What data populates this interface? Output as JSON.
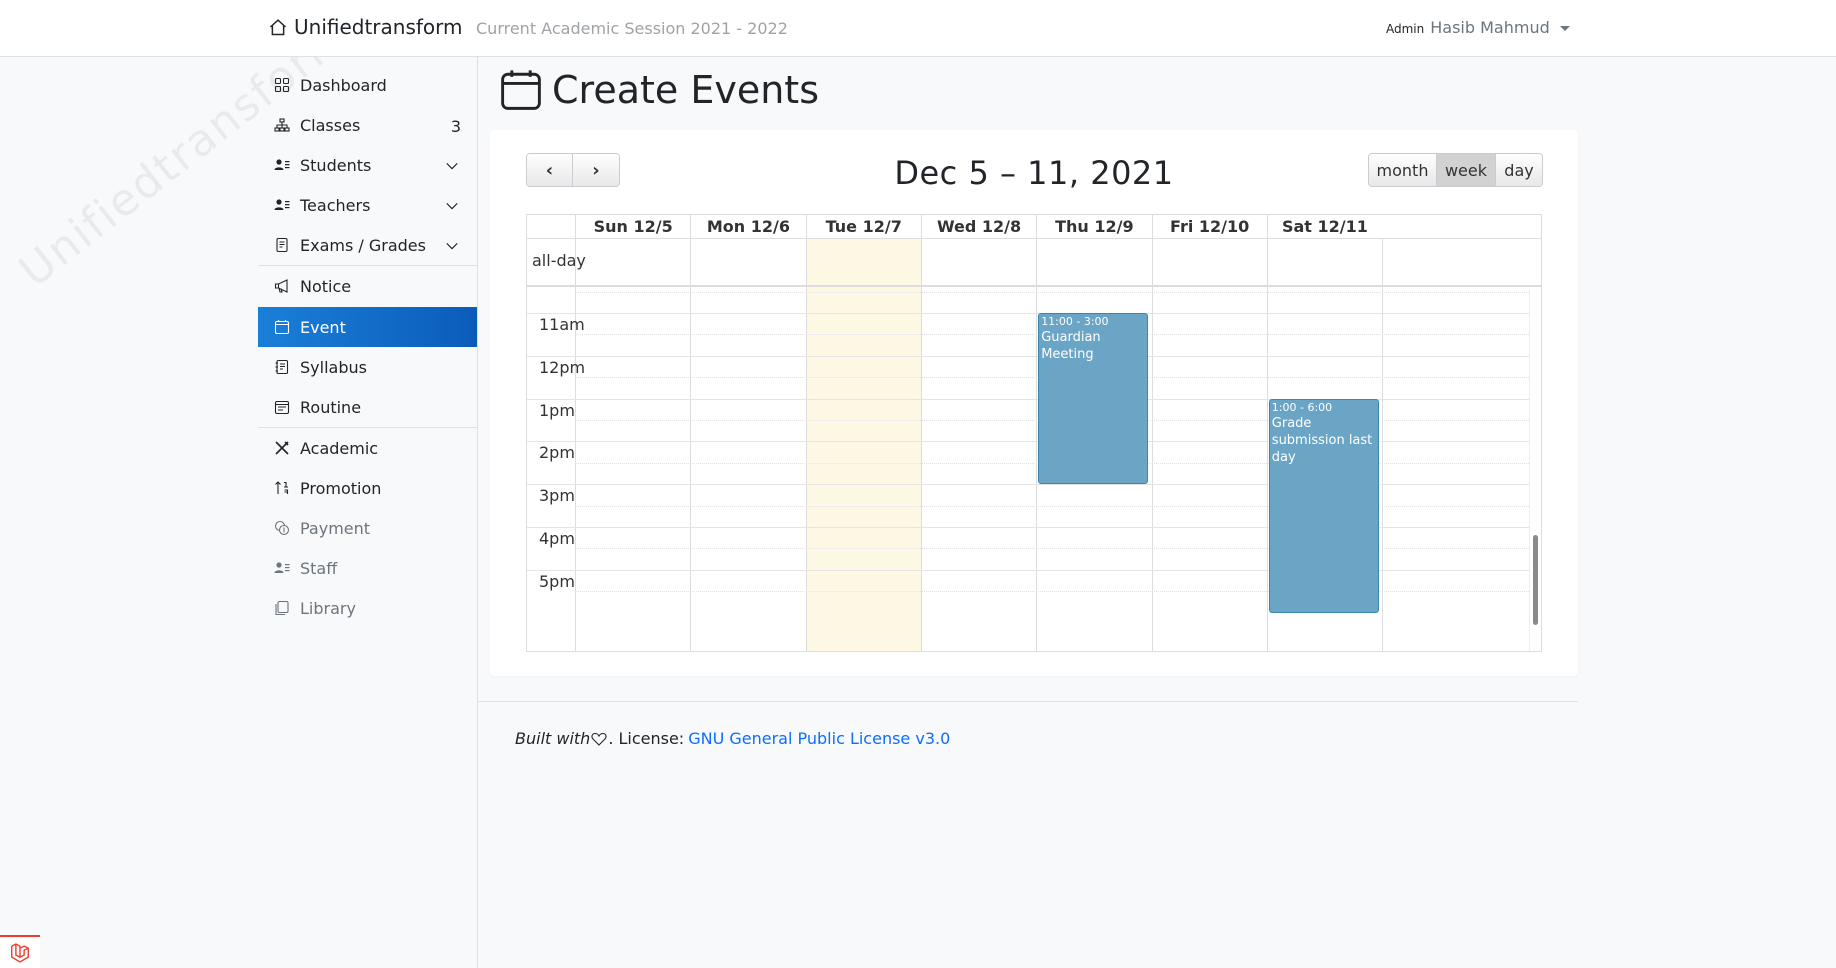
{
  "navbar": {
    "brand": "Unifiedtransform",
    "session": "Current Academic Session 2021 - 2022",
    "role": "Admin",
    "user_name": "Hasib Mahmud"
  },
  "sidebar": {
    "watermark": "Unifiedtransform",
    "items": [
      {
        "label": "Dashboard",
        "icon": "grid-icon"
      },
      {
        "label": "Classes",
        "icon": "diagram-icon",
        "badge": "3"
      },
      {
        "label": "Students",
        "icon": "person-lines-icon",
        "chevron": true
      },
      {
        "label": "Teachers",
        "icon": "person-lines-icon",
        "chevron": true
      },
      {
        "label": "Exams / Grades",
        "icon": "file-text-icon",
        "chevron": true
      },
      {
        "label": "Notice",
        "icon": "megaphone-icon"
      },
      {
        "label": "Event",
        "icon": "calendar-icon",
        "active": true
      },
      {
        "label": "Syllabus",
        "icon": "journal-text-icon"
      },
      {
        "label": "Routine",
        "icon": "calendar-week-icon"
      },
      {
        "label": "Academic",
        "icon": "tools-icon"
      },
      {
        "label": "Promotion",
        "icon": "sort-numeric-up-icon"
      },
      {
        "label": "Payment",
        "icon": "coin-icon",
        "muted": true
      },
      {
        "label": "Staff",
        "icon": "person-lines-icon",
        "muted": true
      },
      {
        "label": "Library",
        "icon": "journals-icon",
        "muted": true
      }
    ]
  },
  "page": {
    "title": "Create Events"
  },
  "calendar": {
    "prev_label": "‹",
    "next_label": "›",
    "range_title": "Dec 5 – 11, 2021",
    "views": [
      "month",
      "week",
      "day"
    ],
    "active_view": "week",
    "days": [
      "Sun 12/5",
      "Mon 12/6",
      "Tue 12/7",
      "Wed 12/8",
      "Thu 12/9",
      "Fri 12/10",
      "Sat 12/11"
    ],
    "today": "Tue 12/7",
    "allday_label": "all-day",
    "time_labels": [
      "11am",
      "12pm",
      "1pm",
      "2pm",
      "3pm",
      "4pm",
      "5pm"
    ],
    "events": [
      {
        "day": "Thu 12/9",
        "time": "11:00 - 3:00",
        "title": "Guardian Meeting",
        "color": "#6ba5c6"
      },
      {
        "day": "Sat 12/11",
        "time": "1:00 - 6:00",
        "title": "Grade submission last day",
        "color": "#6ba5c6"
      }
    ]
  },
  "footer": {
    "built_with": "Built with",
    "license_label": ". License:",
    "license_link": "GNU General Public License v3.0"
  },
  "colors": {
    "primary": "#0d6efd",
    "active_nav": "#0b5cb9",
    "event": "#6ba5c6",
    "today": "#fcf8e3"
  }
}
